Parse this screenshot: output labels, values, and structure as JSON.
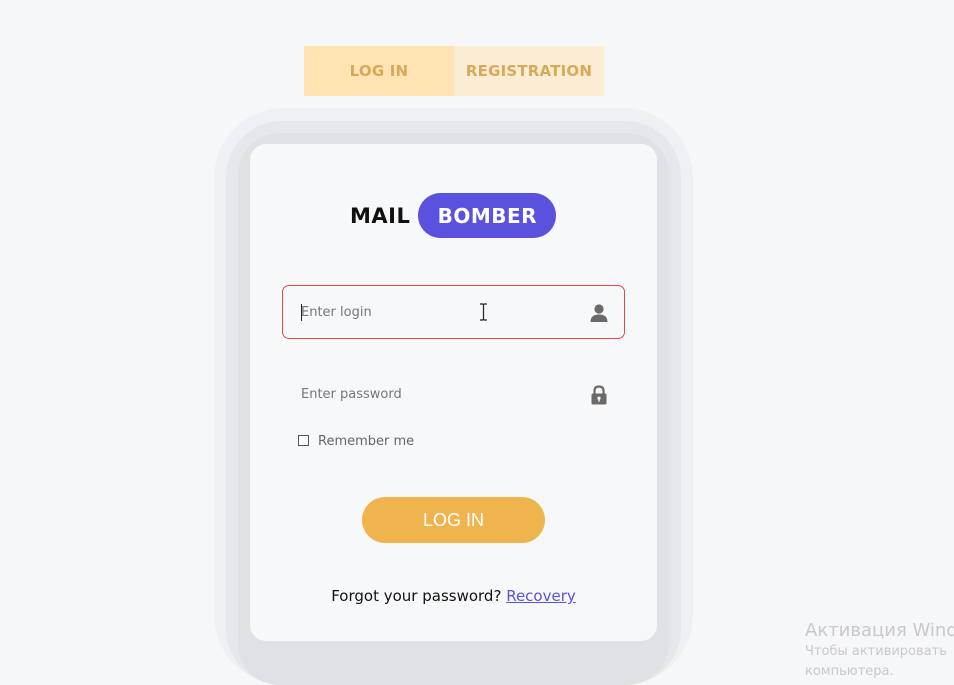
{
  "tabs": {
    "login_label": "LOG IN",
    "registration_label": "REGISTRATION"
  },
  "logo": {
    "part1": "MAIL",
    "part2": "BOMBER"
  },
  "form": {
    "login": {
      "value": "",
      "placeholder": "Enter login",
      "icon": "user-icon",
      "state": "focused-error"
    },
    "password": {
      "value": "",
      "placeholder": "Enter password",
      "icon": "lock-icon"
    },
    "remember": {
      "label": "Remember me",
      "checked": false
    },
    "submit_label": "LOG IN",
    "forgot_text": "Forgot your password?",
    "recovery_link": "Recovery"
  },
  "watermark": {
    "title": "Активация Wind",
    "line1": "Чтобы активировать",
    "line2": "компьютера."
  },
  "colors": {
    "accent": "#5a52de",
    "button": "#f0b44f",
    "tab_text": "#d9a95a",
    "tab_active_bg": "#fde4b2",
    "tab_inactive_bg": "#fbecd4",
    "error_border": "#e54848"
  }
}
